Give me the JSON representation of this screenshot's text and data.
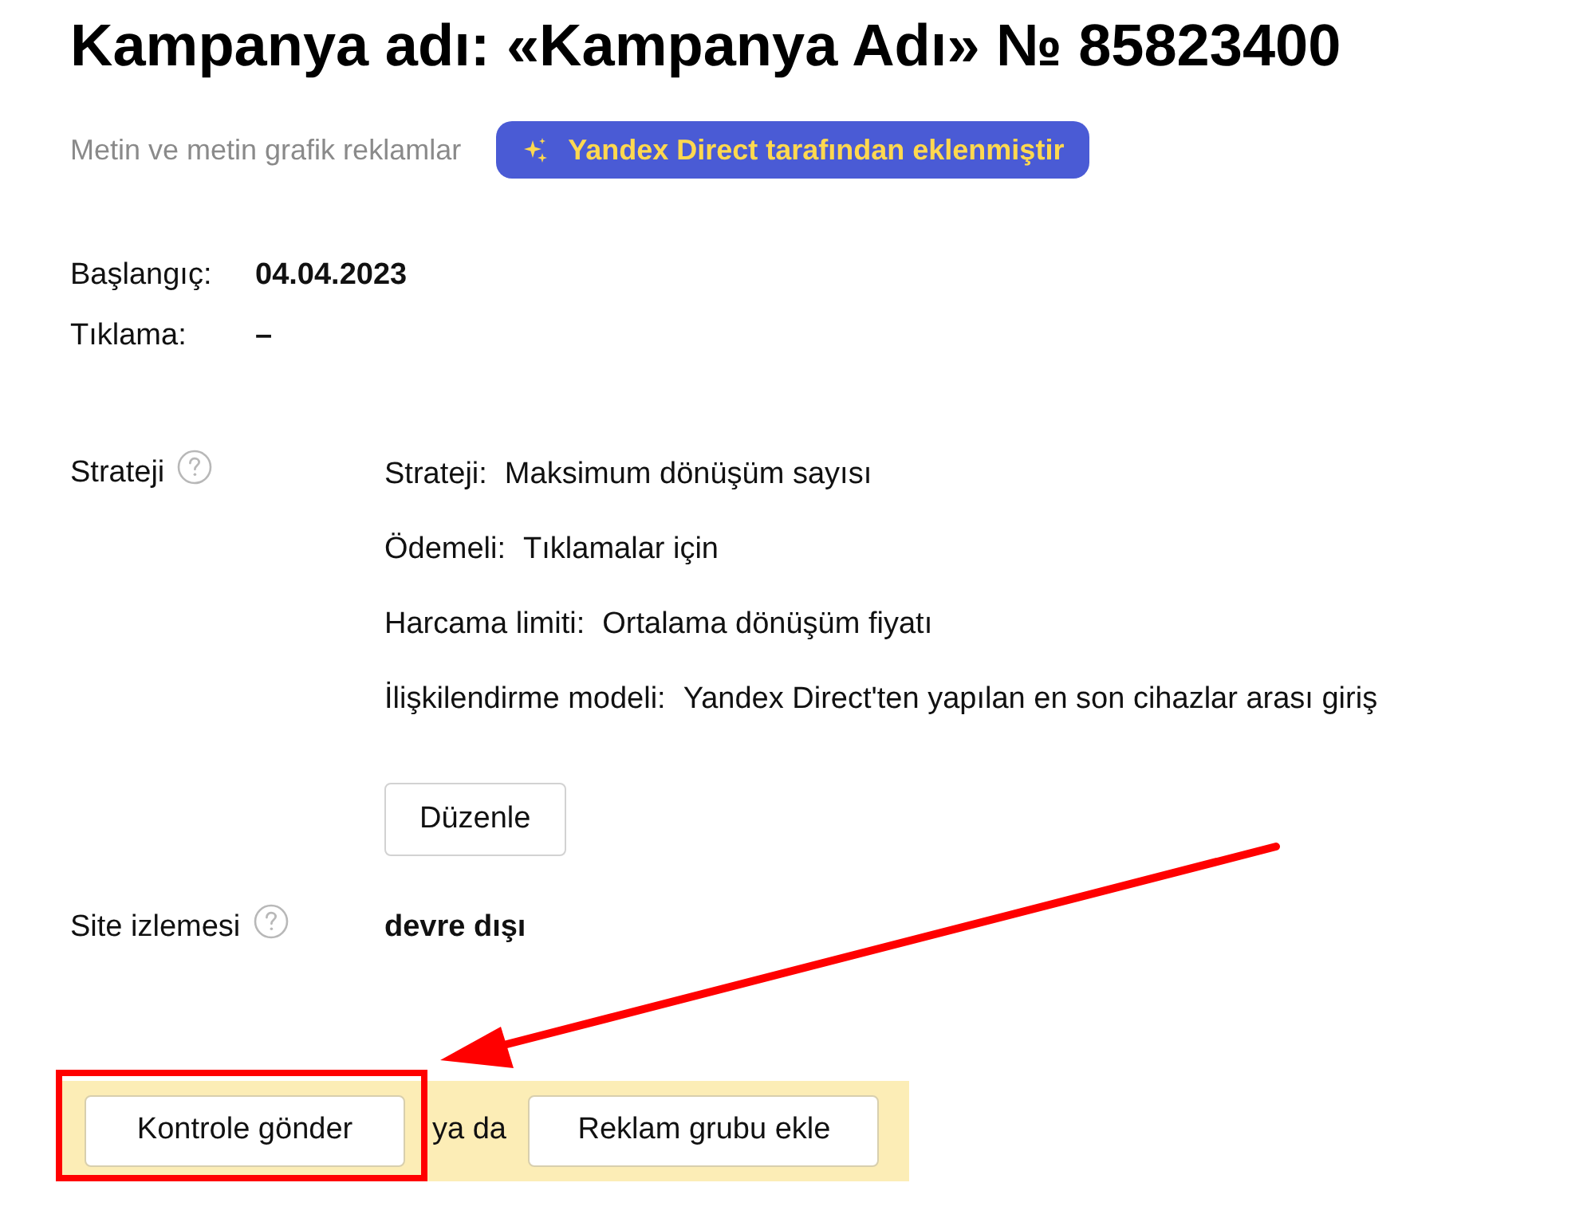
{
  "header": {
    "title": "Kampanya adı: «Kampanya Adı» № 85823400",
    "subtitle": "Metin ve metin grafik reklamlar",
    "badge": "Yandex Direct tarafından eklenmiştir"
  },
  "info": [
    {
      "label": "Başlangıç:",
      "value": "04.04.2023"
    },
    {
      "label": "Tıklama:",
      "value": "–"
    }
  ],
  "strategy": {
    "label": "Strateji",
    "details": [
      {
        "label": "Strateji:",
        "value": "Maksimum dönüşüm sayısı"
      },
      {
        "label": "Ödemeli:",
        "value": "Tıklamalar için"
      },
      {
        "label": "Harcama limiti:",
        "value": "Ortalama dönüşüm fiyatı"
      },
      {
        "label": "İlişkilendirme modeli:",
        "value": "Yandex Direct'ten yapılan en son cihazlar arası giriş"
      }
    ],
    "edit_button": "Düzenle"
  },
  "site_tracking": {
    "label": "Site izlemesi",
    "value": "devre dışı"
  },
  "actions": {
    "primary_button": "Kontrole gönder",
    "separator": "ya da",
    "secondary_button": "Reklam grubu ekle"
  }
}
